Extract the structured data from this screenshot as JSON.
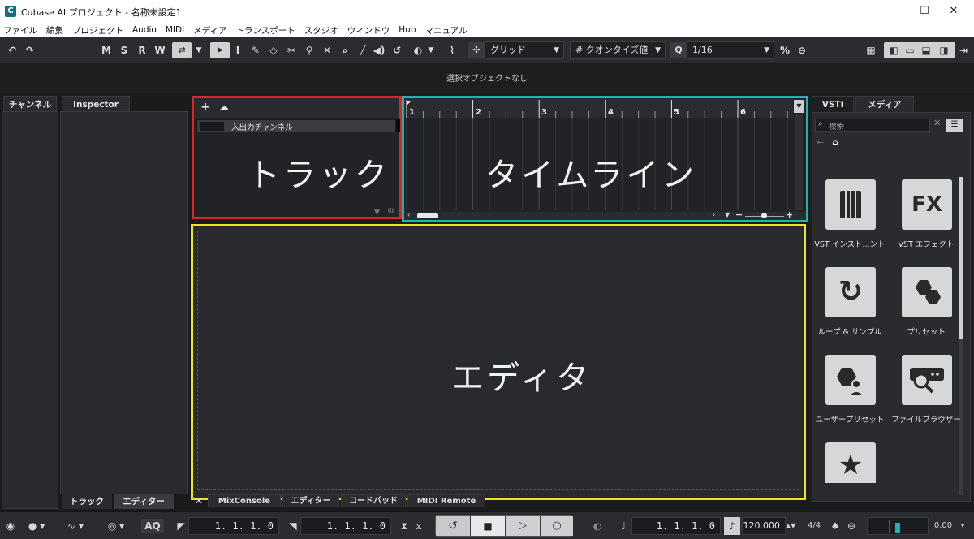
{
  "window": {
    "title": "Cubase AI プロジェクト - 名称未設定1",
    "app_icon": "C",
    "minimize": "—",
    "maximize": "☐",
    "close": "✕"
  },
  "menu": [
    "ファイル",
    "編集",
    "プロジェクト",
    "Audio",
    "MIDI",
    "メディア",
    "トランスポート",
    "スタジオ",
    "ウィンドウ",
    "Hub",
    "マニュアル"
  ],
  "toolbar": {
    "undo": "↶",
    "redo": "↷",
    "m": "M",
    "s": "S",
    "r": "R",
    "w": "W",
    "grid_label": "グリッド",
    "quantize_label": "クオンタイズ値",
    "q_label": "Q",
    "q_value": "1/16"
  },
  "status": {
    "text": "選択オブジェクトなし"
  },
  "left": {
    "channel_tab": "チャンネル",
    "inspector_tab": "Inspector",
    "bottom_track_tab": "トラック",
    "bottom_editor_tab": "エディター"
  },
  "tracks": {
    "channel_row": "入出力チャンネル",
    "label": "トラック"
  },
  "timeline": {
    "label": "タイムライン",
    "bars": [
      "1",
      "2",
      "3",
      "4",
      "5",
      "6"
    ]
  },
  "editor": {
    "label": "エディタ"
  },
  "lower_tabs": [
    "MixConsole",
    "エディター",
    "コードパッド",
    "MIDI Remote"
  ],
  "right": {
    "tab_vsti": "VSTi",
    "tab_media": "メディア",
    "search_placeholder": "検索",
    "tiles": [
      {
        "label": "VST インスト...ント",
        "icon": "piano-keys-icon",
        "glyph": ""
      },
      {
        "label": "VST エフェクト",
        "icon": "fx-icon",
        "glyph": "FX"
      },
      {
        "label": "ループ & サンプル",
        "icon": "loop-icon",
        "glyph": "↻"
      },
      {
        "label": "プリセット",
        "icon": "hexagons-icon",
        "glyph": ""
      },
      {
        "label": "ユーザープリセット",
        "icon": "user-preset-icon",
        "glyph": ""
      },
      {
        "label": "ファイルブラウザー",
        "icon": "file-browser-icon",
        "glyph": ""
      },
      {
        "label": "",
        "icon": "star-icon",
        "glyph": "★"
      }
    ]
  },
  "transport": {
    "aq": "AQ",
    "left_locator": "1. 1. 1.  0",
    "right_locator": "1. 1. 1.  0",
    "position": "1. 1. 1.  0",
    "tempo": "120.000",
    "signature": "4/4",
    "level": "0.00"
  },
  "colors": {
    "tracks_border": "#d9281c",
    "timeline_border": "#19b5b8",
    "editor_border": "#f0e41f",
    "meter_red": "#e02020",
    "meter_cyan": "#19b5b8"
  }
}
